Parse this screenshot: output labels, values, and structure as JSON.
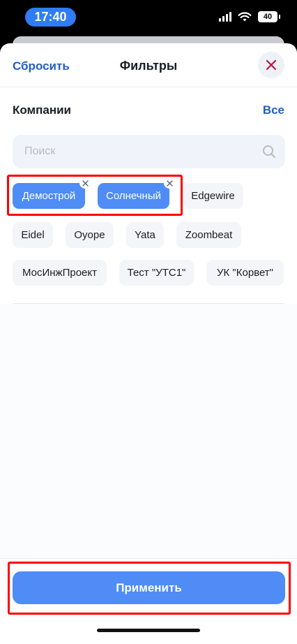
{
  "status_bar": {
    "time": "17:40",
    "battery": "40"
  },
  "header": {
    "reset_label": "Сбросить",
    "title": "Фильтры"
  },
  "companies": {
    "section_title": "Компании",
    "all_label": "Все",
    "search_placeholder": "Поиск",
    "chips": [
      {
        "label": "Демострой",
        "selected": true
      },
      {
        "label": "Солнечный",
        "selected": true
      },
      {
        "label": "Edgewire",
        "selected": false
      },
      {
        "label": "Eidel",
        "selected": false
      },
      {
        "label": "Oyope",
        "selected": false
      },
      {
        "label": "Yata",
        "selected": false
      },
      {
        "label": "Zoombeat",
        "selected": false
      },
      {
        "label": "МосИнжПроект",
        "selected": false
      },
      {
        "label": "Тест \"УТС1\"",
        "selected": false
      },
      {
        "label": "УК \"Корвет\"",
        "selected": false
      }
    ]
  },
  "footer": {
    "apply_label": "Применить"
  },
  "colors": {
    "accent": "#4f8cf6",
    "link": "#1f5fbf",
    "highlight": "#ff0000"
  }
}
